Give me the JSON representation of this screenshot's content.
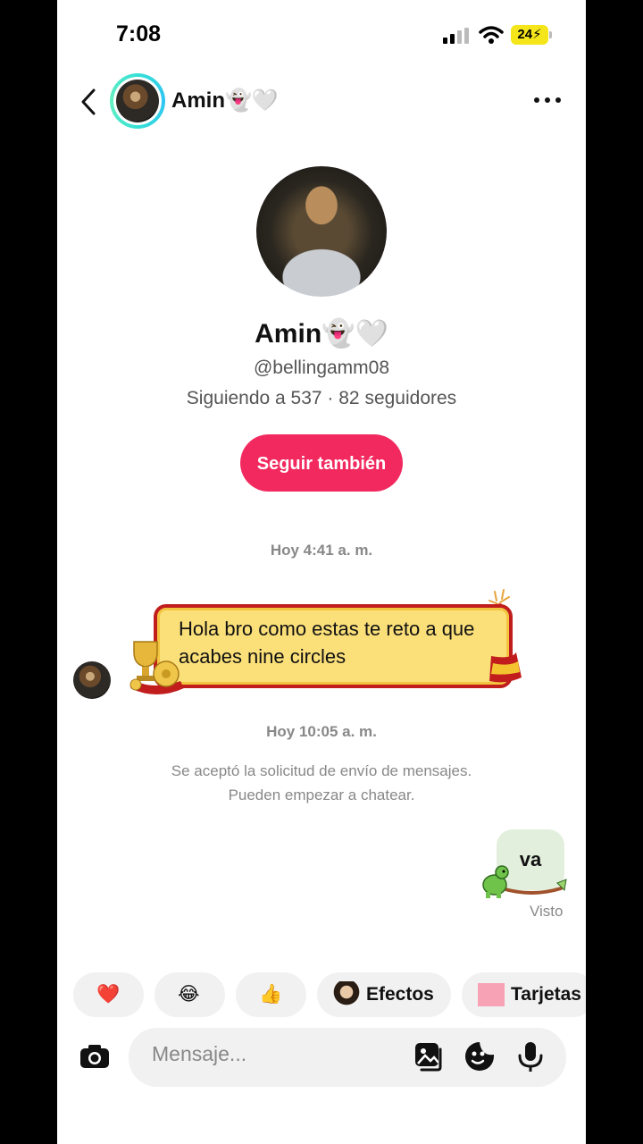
{
  "status_bar": {
    "time": "7:08",
    "battery": "24"
  },
  "header": {
    "name": "Amin👻🤍"
  },
  "profile": {
    "name": "Amin👻🤍",
    "handle": "@bellingamm08",
    "stats": "Siguiendo a 537 · 82 seguidores",
    "follow_label": "Seguir también"
  },
  "chat": {
    "timestamp_1": "Hoy 4:41 a. m.",
    "incoming_message": "Hola bro como estas te reto a que acabes nine circles",
    "timestamp_2": "Hoy 10:05 a. m.",
    "system_line_1": "Se aceptó la solicitud de envío de mensajes.",
    "system_line_2": "Pueden empezar a chatear.",
    "outgoing_message": "va",
    "seen_label": "Visto"
  },
  "quick_reactions": {
    "heart": "❤️",
    "laugh": "😂",
    "thumbs": "👍",
    "effects_label": "Efectos",
    "cards_label": "Tarjetas"
  },
  "composer": {
    "placeholder": "Mensaje..."
  },
  "colors": {
    "follow_button": "#f2295f",
    "bubble_in": "#fbe07a",
    "bubble_in_border": "#c11d1d",
    "bubble_out": "#e3efdd"
  }
}
